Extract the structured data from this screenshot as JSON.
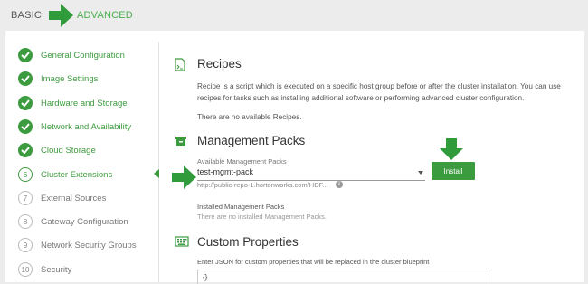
{
  "modes": {
    "basic": "BASIC",
    "advanced": "ADVANCED"
  },
  "sidebar": {
    "items": [
      {
        "label": "General Configuration",
        "state": "done"
      },
      {
        "label": "Image Settings",
        "state": "done"
      },
      {
        "label": "Hardware and Storage",
        "state": "done"
      },
      {
        "label": "Network and Availability",
        "state": "done"
      },
      {
        "label": "Cloud Storage",
        "state": "done"
      },
      {
        "label": "Cluster Extensions",
        "state": "active",
        "number": "6"
      },
      {
        "label": "External Sources",
        "state": "todo",
        "number": "7"
      },
      {
        "label": "Gateway Configuration",
        "state": "todo",
        "number": "8"
      },
      {
        "label": "Network Security Groups",
        "state": "todo",
        "number": "9"
      },
      {
        "label": "Security",
        "state": "todo",
        "number": "10"
      }
    ]
  },
  "recipes": {
    "title": "Recipes",
    "description_line1": "Recipe is a script which is executed on a specific host group before or after the cluster installation. You can use",
    "description_line2": "recipes for tasks such as installing additional software or performing advanced cluster configuration.",
    "empty": "There are no available Recipes."
  },
  "mpacks": {
    "title": "Management Packs",
    "available_label": "Available Management Packs",
    "selected": "test-mgmt-pack",
    "url": "http://public-repo-1.hortonworks.com/HDF...",
    "install_label": "Install",
    "installed_label": "Installed Management Packs",
    "installed_empty": "There are no installed Management Packs."
  },
  "custom": {
    "title": "Custom Properties",
    "hint": "Enter JSON for custom properties that will be replaced in the cluster blueprint",
    "value": "{}"
  },
  "colors": {
    "accent": "#3c9b3e",
    "arrow": "#2f9b3a",
    "background": "#ececec"
  },
  "icons": [
    "checkmark-icon",
    "recipe-file-icon",
    "package-box-icon",
    "keyboard-icon",
    "info-icon",
    "arrow-right-icon",
    "arrow-down-icon"
  ]
}
